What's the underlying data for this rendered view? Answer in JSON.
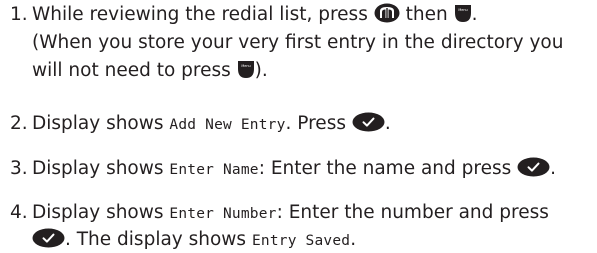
{
  "colors": {
    "text": "#231f20",
    "icon_fill": "#231f20",
    "icon_symbol": "#ffffff"
  },
  "icons": {
    "phonebook": "phonebook-key-icon",
    "menu": "menu-key-icon",
    "ok": "ok-key-icon",
    "menu_label": "Menu"
  },
  "steps": [
    {
      "number": "1.",
      "line1_a": "While reviewing the redial list, press",
      "line1_b": "then",
      "line1_c": ".",
      "line2": "(When you store your very first entry in the directory you",
      "line3_a": "will not need to press",
      "line3_b": ")."
    },
    {
      "number": "2.",
      "text_a": "Display shows",
      "display": "Add New Entry",
      "text_b": ". Press",
      "text_c": "."
    },
    {
      "number": "3.",
      "text_a": "Display shows",
      "display": "Enter Name",
      "text_b": ": Enter the name and press",
      "text_c": "."
    },
    {
      "number": "4.",
      "text_a": "Display shows",
      "display": "Enter Number",
      "text_b": ": Enter the number and press",
      "line2_a": ". The display shows",
      "line2_display": "Entry Saved",
      "line2_b": "."
    }
  ]
}
